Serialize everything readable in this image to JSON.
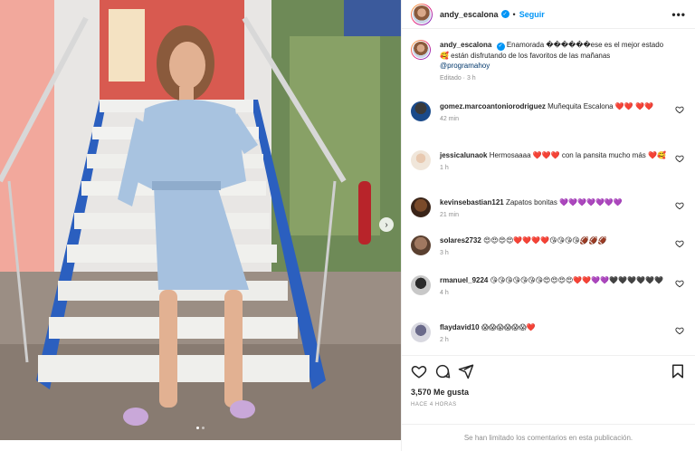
{
  "post": {
    "username": "andy_escalona",
    "follow_label": "Seguir",
    "more_label": "•••"
  },
  "caption": {
    "username": "andy_escalona",
    "text": "Enamorada ������ese es el mejor estado 🥰 están disfrutando de los favoritos de las mañanas",
    "mention": "@programahoy",
    "meta": "Editado · 3 h"
  },
  "comments": [
    {
      "username": "gomez.marcoantoniorodriguez",
      "text": "Muñequita Escalona ❤️❤️ ❤️❤️",
      "meta": "42 min"
    },
    {
      "username": "jessicalunaok",
      "text": "Hermosaaaa ❤️❤️❤️ con la pansita mucho más ❤️🥰",
      "meta": "1 h"
    },
    {
      "username": "kevinsebastian121",
      "text": "Zapatos bonitas 💜💜💜💜💜💜💜",
      "meta": "21 min"
    },
    {
      "username": "solares2732",
      "text": "😍😍😍😍❤️❤️❤️❤️😘😘😘😘🏈🏈🏈",
      "meta": "3 h"
    },
    {
      "username": "rmanuel_9224",
      "text": "😘😘😘😘😘😘😘😍😍😍😍❤️❤️💜💜🖤🖤🖤🖤🖤🖤",
      "meta": "4 h"
    },
    {
      "username": "flaydavid10",
      "text": "😱😱😱😱😱😱❤️",
      "meta": "2 h"
    }
  ],
  "likes": "3,570 Me gusta",
  "time_ago": "HACE 4 HORAS",
  "limited": "Se han limitado los comentarios en esta publicación.",
  "icons": {
    "like": "heart-icon",
    "comment": "comment-icon",
    "share": "share-icon",
    "save": "bookmark-icon"
  }
}
